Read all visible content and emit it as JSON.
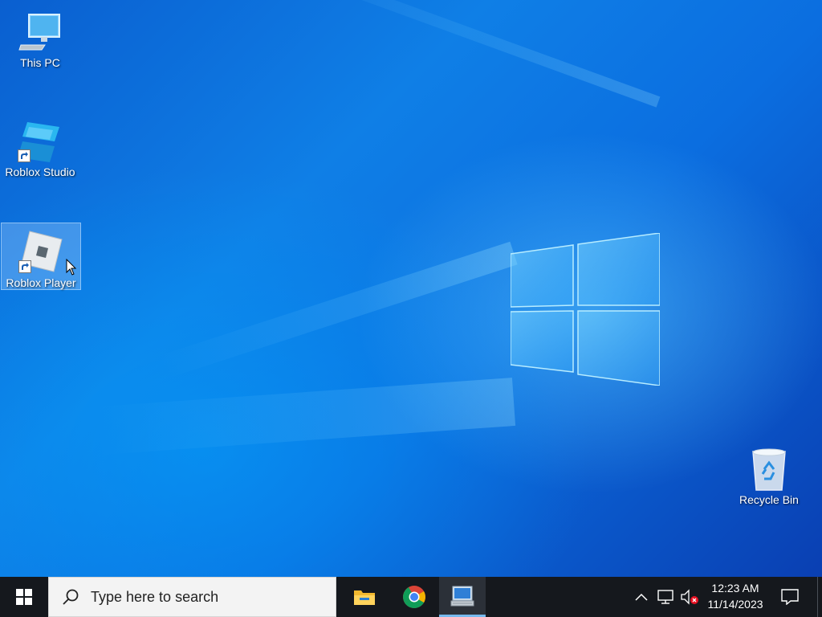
{
  "desktop": {
    "icons": [
      {
        "label": "This PC",
        "icon": "this-pc-icon"
      },
      {
        "label": "Roblox Studio",
        "icon": "roblox-studio-icon"
      },
      {
        "label": "Roblox Player",
        "icon": "roblox-player-icon",
        "selected": true
      },
      {
        "label": "Recycle Bin",
        "icon": "recycle-bin-icon"
      }
    ]
  },
  "taskbar": {
    "start_icon": "windows-logo-icon",
    "search": {
      "placeholder": "Type here to search",
      "icon": "search-icon"
    },
    "pinned_apps": [
      {
        "name": "File Explorer",
        "icon": "file-explorer-icon"
      },
      {
        "name": "Google Chrome",
        "icon": "chrome-icon"
      },
      {
        "name": "Remote Desktop",
        "icon": "remote-desktop-icon",
        "active": true
      }
    ],
    "tray": {
      "icons": [
        "chevron-up-icon",
        "network-icon",
        "volume-muted-icon"
      ],
      "time": "12:23 AM",
      "date": "11/14/2023"
    },
    "action_center_icon": "notification-icon"
  },
  "colors": {
    "taskbar_bg": "#15181d",
    "active_indicator": "#76b9ed",
    "wallpaper_blue": "#0b6ee0"
  }
}
